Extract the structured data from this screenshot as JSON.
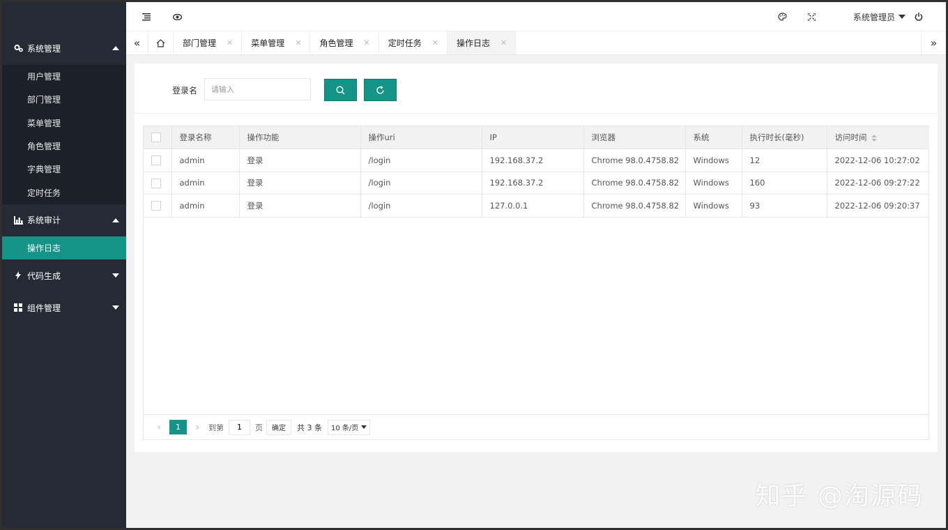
{
  "sidebar": {
    "groups": [
      {
        "label": "系统管理",
        "icon": "gears-icon",
        "expanded": true,
        "items": [
          "用户管理",
          "部门管理",
          "菜单管理",
          "角色管理",
          "字典管理",
          "定时任务"
        ]
      },
      {
        "label": "系统审计",
        "icon": "bar-chart-icon",
        "expanded": true,
        "items": [
          "操作日志"
        ]
      },
      {
        "label": "代码生成",
        "icon": "bolt-icon",
        "expanded": false
      },
      {
        "label": "组件管理",
        "icon": "grid-icon",
        "expanded": false
      }
    ],
    "active_item": "操作日志"
  },
  "header": {
    "icons": [
      "menu-toggle-icon",
      "eye-icon",
      "palette-icon",
      "fullscreen-icon",
      "power-icon"
    ],
    "user_label": "系统管理员"
  },
  "tabs": {
    "items": [
      {
        "label": "部门管理"
      },
      {
        "label": "菜单管理"
      },
      {
        "label": "角色管理"
      },
      {
        "label": "定时任务"
      },
      {
        "label": "操作日志",
        "active": true
      }
    ]
  },
  "search": {
    "label": "登录名",
    "placeholder": "请输入"
  },
  "table": {
    "columns": [
      "登录名称",
      "操作功能",
      "操作uri",
      "IP",
      "浏览器",
      "系统",
      "执行时长(毫秒)",
      "访问时间"
    ],
    "rows": [
      [
        "admin",
        "登录",
        "/login",
        "192.168.37.2",
        "Chrome 98.0.4758.82",
        "Windows",
        "12",
        "2022-12-06 10:27:02"
      ],
      [
        "admin",
        "登录",
        "/login",
        "192.168.37.2",
        "Chrome 98.0.4758.82",
        "Windows",
        "160",
        "2022-12-06 09:27:22"
      ],
      [
        "admin",
        "登录",
        "/login",
        "127.0.0.1",
        "Chrome 98.0.4758.82",
        "Windows",
        "93",
        "2022-12-06 09:20:37"
      ]
    ]
  },
  "pager": {
    "current_page": "1",
    "goto_label": "到第",
    "goto_value": "1",
    "page_unit": "页",
    "ok_label": "确定",
    "total_label": "共 3 条",
    "page_size": "10 条/页"
  },
  "watermark": "知乎 @淘源码",
  "colors": {
    "accent": "#149487",
    "sidebar_bg": "#252a35",
    "sidebar_sub_bg": "#1c2029"
  }
}
